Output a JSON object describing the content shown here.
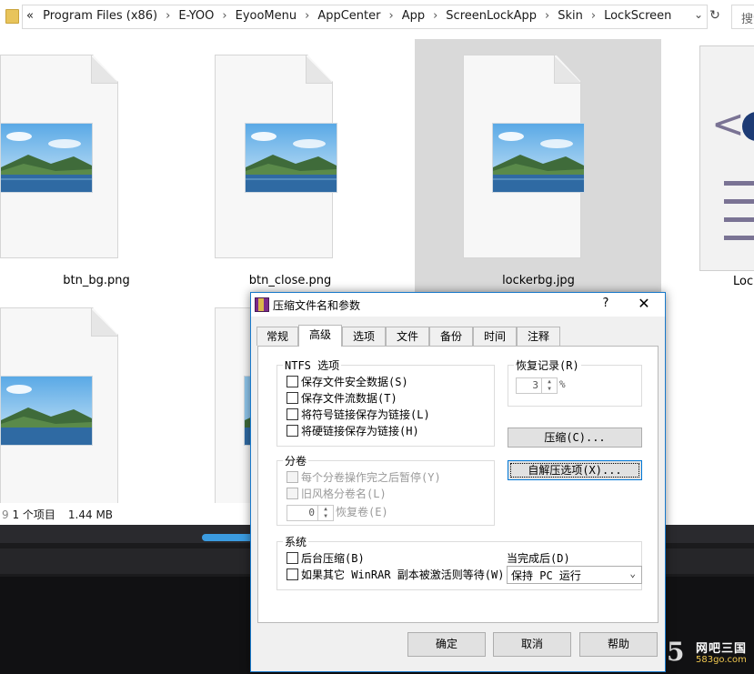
{
  "explorer": {
    "breadcrumb": [
      "Program Files (x86)",
      "E-YOO",
      "EyooMenu",
      "AppCenter",
      "App",
      "ScreenLockApp",
      "Skin",
      "LockScreen"
    ],
    "overflow_label": "«",
    "search_placeholder": "搜索",
    "files": [
      {
        "name": "btn_bg.png",
        "selected": false
      },
      {
        "name": "btn_close.png",
        "selected": false
      },
      {
        "name": "lockerbg.jpg",
        "selected": true
      },
      {
        "name": "Lock"
      }
    ],
    "status": {
      "count": "1 个项目",
      "size": "1.44 MB"
    }
  },
  "dialog": {
    "title": "压缩文件名和参数",
    "help_label": "?",
    "close_label": "✕",
    "tabs": [
      "常规",
      "高级",
      "选项",
      "文件",
      "备份",
      "时间",
      "注释"
    ],
    "active_tab": "高级",
    "ntfs": {
      "title": "NTFS 选项",
      "options": [
        "保存文件安全数据(S)",
        "保存文件流数据(T)",
        "将符号链接保存为链接(L)",
        "将硬链接保存为链接(H)"
      ]
    },
    "volumes": {
      "title": "分卷",
      "options": [
        "每个分卷操作完之后暂停(Y)",
        "旧风格分卷名(L)"
      ],
      "recovery_value": "0",
      "recovery_label": "恢复卷(E)"
    },
    "system": {
      "title": "系统",
      "options": [
        "后台压缩(B)",
        "如果其它 WinRAR 副本被激活则等待(W)"
      ]
    },
    "recovery_record": {
      "title": "恢复记录(R)",
      "value": "3",
      "unit": "%"
    },
    "compress_button": "压缩(C)...",
    "sfx_button": "自解压选项(X)...",
    "after_done_label": "当完成后(D)",
    "after_done_value": "保持 PC 运行",
    "ok_button": "确定",
    "cancel_button": "取消",
    "help_button": "帮助"
  },
  "watermark": {
    "logo": "5",
    "title": "网吧三国",
    "url": "583go.com"
  }
}
